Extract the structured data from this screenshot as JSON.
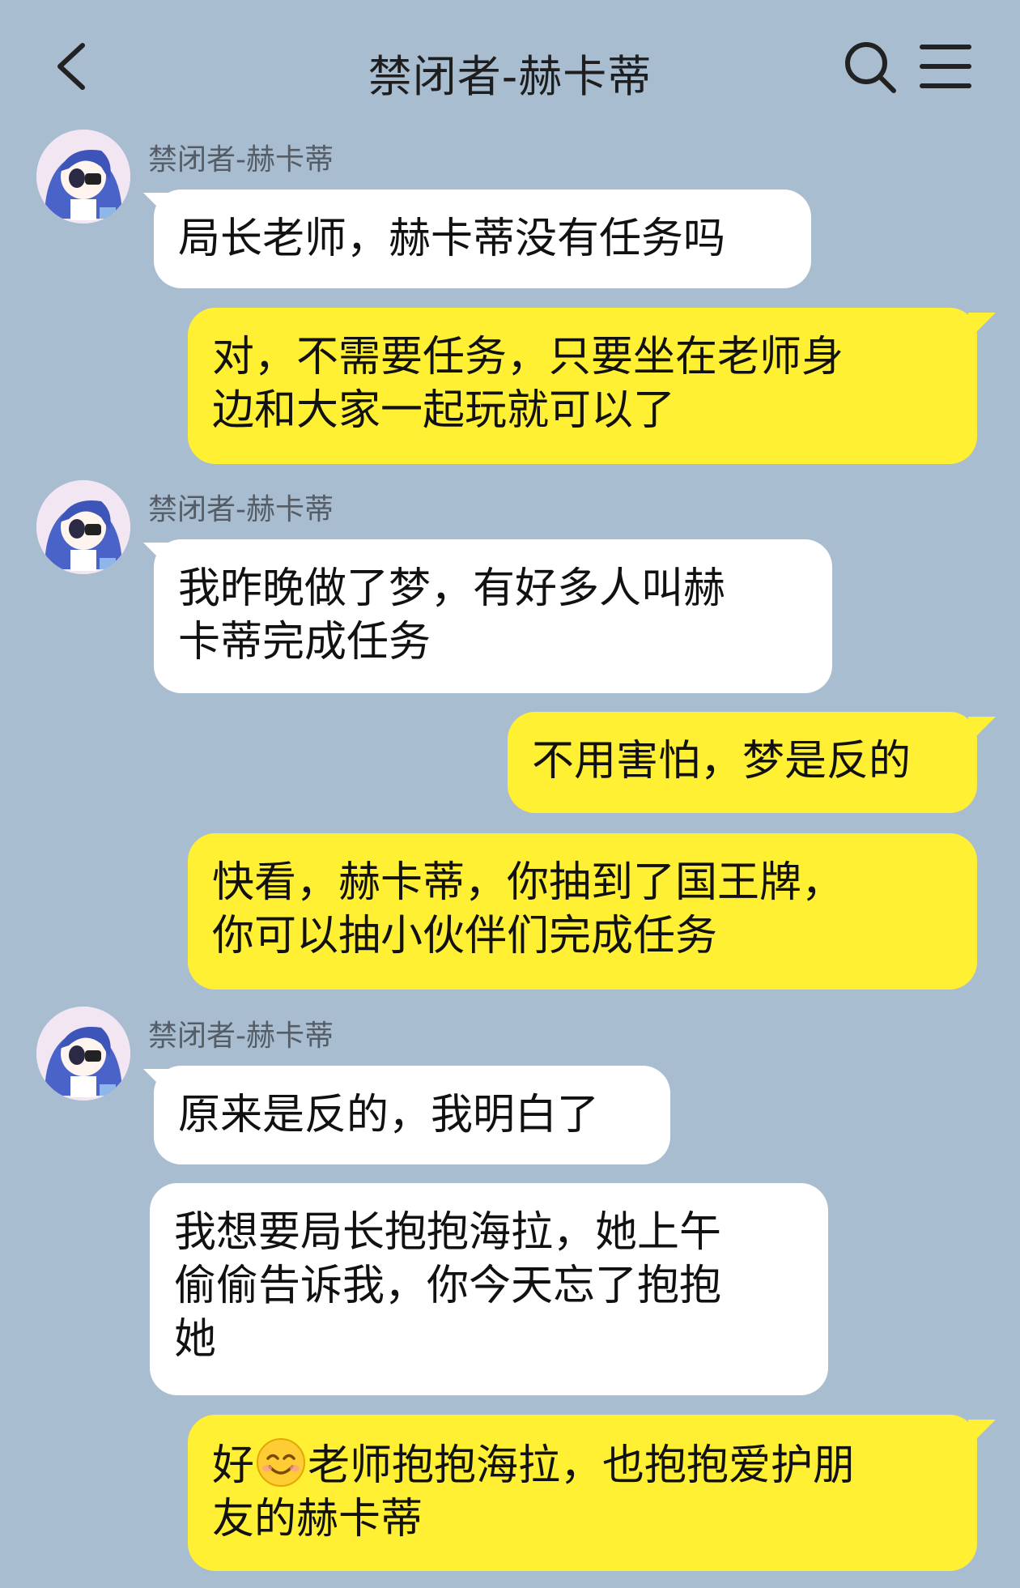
{
  "header": {
    "title": "禁闭者-赫卡蒂"
  },
  "colors": {
    "background": "#a9bdd1",
    "incoming_bubble": "#ffffff",
    "outgoing_bubble": "#fff033"
  },
  "icons": {
    "back": "chevron-left-icon",
    "search": "search-icon",
    "menu": "menu-icon",
    "emoji": "smiling-face-emoji"
  },
  "messages": [
    {
      "from": "them",
      "sender": "禁闭者-赫卡蒂",
      "text": "局长老师，赫卡蒂没有任务吗"
    },
    {
      "from": "me",
      "text": "对，不需要任务，只要坐在老师身\n边和大家一起玩就可以了"
    },
    {
      "from": "them",
      "sender": "禁闭者-赫卡蒂",
      "text": "我昨晚做了梦，有好多人叫赫\n卡蒂完成任务"
    },
    {
      "from": "me",
      "text": "不用害怕，梦是反的"
    },
    {
      "from": "me",
      "text": "快看，赫卡蒂，你抽到了国王牌，\n你可以抽小伙伴们完成任务"
    },
    {
      "from": "them",
      "sender": "禁闭者-赫卡蒂",
      "text": "原来是反的，我明白了"
    },
    {
      "from": "them",
      "text": "我想要局长抱抱海拉，她上午\n偷偷告诉我，你今天忘了抱抱\n她"
    },
    {
      "from": "me",
      "text_before_emoji": "好",
      "text_after_emoji": "老师抱抱海拉，也抱抱爱护朋\n友的赫卡蒂"
    }
  ]
}
